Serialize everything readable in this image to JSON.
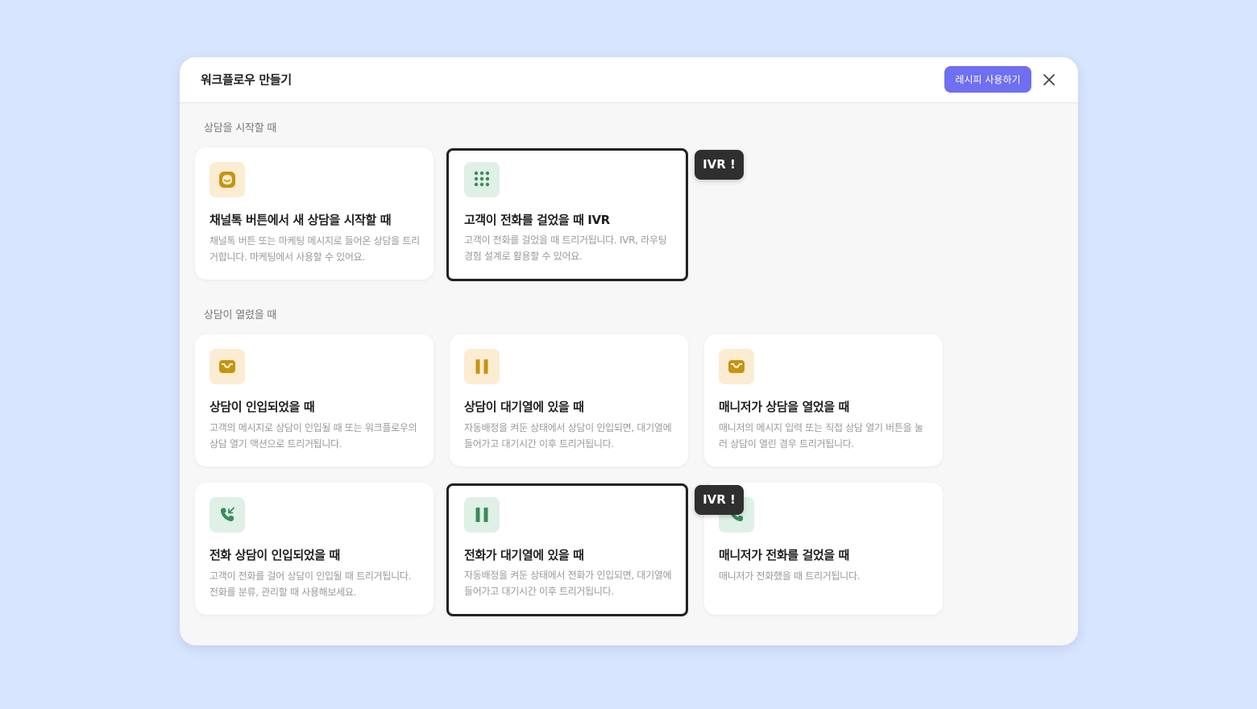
{
  "modal": {
    "title": "워크플로우 만들기",
    "recipe_button": "레시피 사용하기",
    "close_icon": "close-icon"
  },
  "sections": [
    {
      "label": "상담을 시작할 때",
      "cards": [
        {
          "icon": "chat-bubble-icon",
          "icon_color": "#c4950f",
          "icon_bg": "#fcecd2",
          "title": "채널톡 버튼에서 새 상담을 시작할 때",
          "desc": "채널톡 버튼 또는 마케팅 메시지로 들어온 상담을 트리거합니다. 마케팅에서 사용할 수 있어요.",
          "selected": false
        },
        {
          "icon": "dialpad-icon",
          "icon_color": "#3b8a5c",
          "icon_bg": "#dff0e6",
          "title": "고객이 전화를 걸었을 때 IVR",
          "desc": "고객이 전화를 걸었을 때 트리거됩니다. IVR, 라우팅 경험 설계로 활용할 수 있어요.",
          "selected": true,
          "tooltip": "IVR !"
        }
      ]
    },
    {
      "label": "상담이 열렸을 때",
      "cards": [
        {
          "icon": "inbox-icon",
          "icon_color": "#c4950f",
          "icon_bg": "#fcecd2",
          "title": "상담이 인입되었을 때",
          "desc": "고객의 메시지로 상담이 인입될 때 또는 워크플로우의 상담 열기 액션으로 트리거됩니다.",
          "selected": false
        },
        {
          "icon": "pause-icon",
          "icon_color": "#c4950f",
          "icon_bg": "#fcecd2",
          "title": "상담이 대기열에 있을 때",
          "desc": "자동배정을 켜둔 상태에서 상담이 인입되면, 대기열에 들어가고 대기시간 이후 트리거됩니다.",
          "selected": false
        },
        {
          "icon": "inbox-icon",
          "icon_color": "#c4950f",
          "icon_bg": "#fcecd2",
          "title": "매니저가 상담을 열었을 때",
          "desc": "매니저의 메시지 입력 또는 직접 상담 열기 버튼을 눌러 상담이 열린 경우 트리거됩니다.",
          "selected": false
        },
        {
          "icon": "phone-incoming-icon",
          "icon_color": "#3b8a5c",
          "icon_bg": "#dff0e6",
          "title": "전화 상담이 인입되었을 때",
          "desc": "고객이 전화를 걸어 상담이 인입될 때 트리거됩니다. 전화를 분류, 관리할 때 사용해보세요.",
          "selected": false
        },
        {
          "icon": "pause-icon",
          "icon_color": "#3b8a5c",
          "icon_bg": "#dff0e6",
          "title": "전화가 대기열에 있을 때",
          "desc": "자동배정을 켜둔 상태에서 전화가 인입되면, 대기열에 들어가고 대기시간 이후 트리거됩니다.",
          "selected": true,
          "tooltip": "IVR !"
        },
        {
          "icon": "phone-icon",
          "icon_color": "#3b8a5c",
          "icon_bg": "#dff0e6",
          "title": "매니저가 전화를 걸었을 때",
          "desc": "매니저가 전화했을 때 트리거됩니다.",
          "selected": false
        }
      ]
    }
  ]
}
